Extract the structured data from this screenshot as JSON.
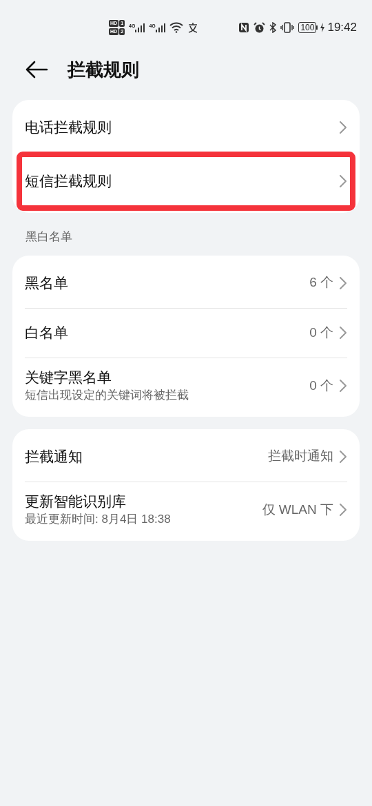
{
  "status_bar": {
    "sim_labels": [
      "HD",
      "1",
      "HD",
      "2"
    ],
    "network": [
      "4G",
      "4G"
    ],
    "battery": "100",
    "time": "19:42"
  },
  "header": {
    "title": "拦截规则"
  },
  "groups": [
    {
      "items": [
        {
          "title": "电话拦截规则",
          "highlighted": false
        },
        {
          "title": "短信拦截规则",
          "highlighted": true
        }
      ]
    },
    {
      "section": "黑白名单",
      "items": [
        {
          "title": "黑名单",
          "value": "6 个",
          "highlighted": false
        },
        {
          "title": "白名单",
          "value": "0 个",
          "highlighted": false
        },
        {
          "title": "关键字黑名单",
          "subtitle": "短信出现设定的关键词将被拦截",
          "value": "0 个",
          "highlighted": false
        }
      ]
    },
    {
      "items": [
        {
          "title": "拦截通知",
          "value": "拦截时通知",
          "highlighted": false
        },
        {
          "title": "更新智能识别库",
          "subtitle": "最近更新时间: 8月4日 18:38",
          "value": "仅 WLAN 下",
          "highlighted": false
        }
      ]
    }
  ]
}
